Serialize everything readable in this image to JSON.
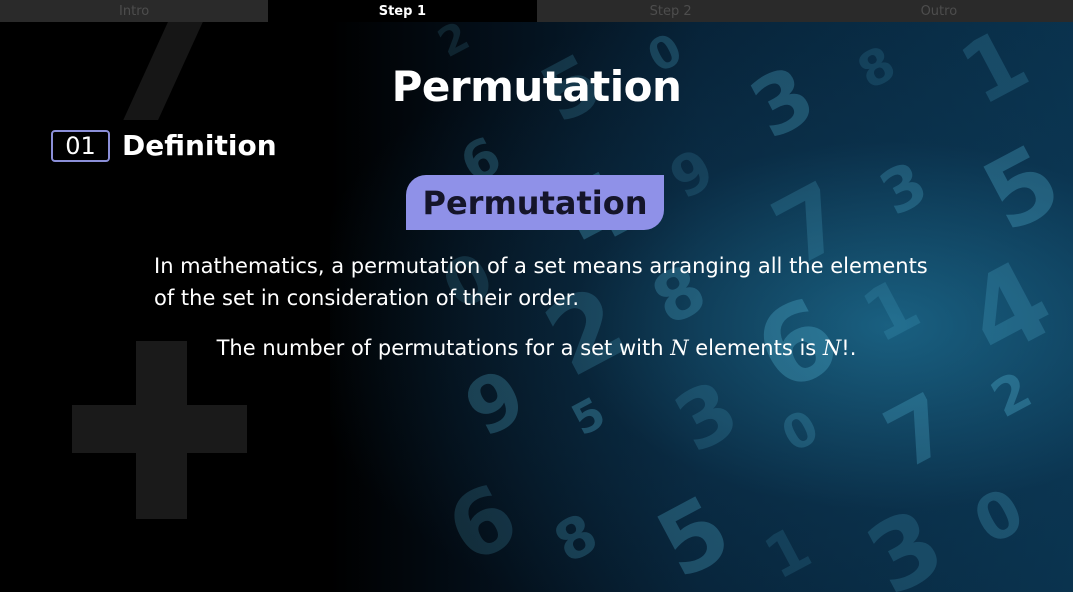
{
  "tabs": [
    {
      "label": "Intro",
      "active": false
    },
    {
      "label": "Step 1",
      "active": true
    },
    {
      "label": "Step 2",
      "active": false
    },
    {
      "label": "Outro",
      "active": false
    }
  ],
  "slide": {
    "title": "Permutation",
    "section": {
      "number": "01",
      "label": "Definition"
    },
    "term": "Permutation",
    "definition": "In mathematics, a permutation of a set means arranging all the elements of the set in consideration of their order.",
    "count_prefix": "The number of permutations for a set with ",
    "count_var": "N",
    "count_middle": " elements is ",
    "count_var2": "N",
    "count_suffix": "!."
  },
  "background": {
    "decorative_digit": "7",
    "digits": [
      "2",
      "5",
      "0",
      "3",
      "8",
      "1",
      "6",
      "4",
      "9",
      "7",
      "3",
      "5",
      "0",
      "2",
      "8",
      "6",
      "1",
      "4",
      "9",
      "5",
      "3",
      "0",
      "7",
      "2",
      "6",
      "8",
      "5",
      "1",
      "3",
      "0"
    ]
  },
  "colors": {
    "accent": "#8f91e8",
    "tab_active_bg": "#000000",
    "tab_inactive_bg": "#2a2a2a",
    "background": "#000000"
  }
}
